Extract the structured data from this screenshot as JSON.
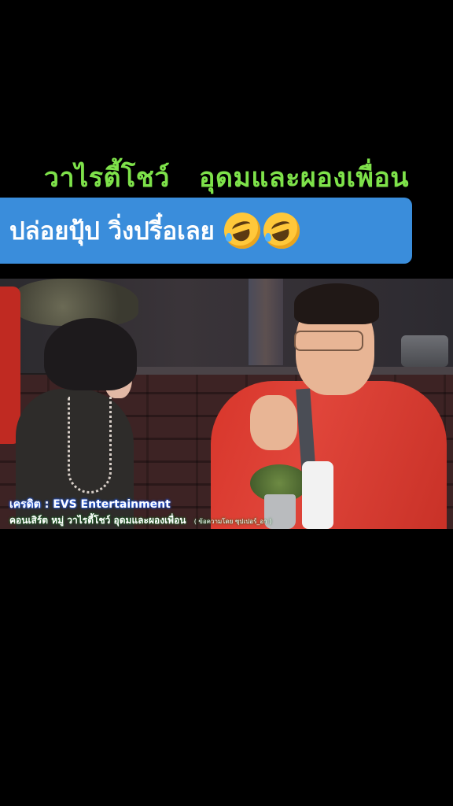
{
  "title": "วาไรตี้โชว์   อุดมและผองเพื่อน",
  "caption": {
    "text": "ปล่อยปุ้ป วิ่งปรี๋อเลย",
    "emojis": [
      "rolling-on-floor-laughing-icon",
      "rolling-on-floor-laughing-icon"
    ]
  },
  "video": {
    "credit": "เครดิต : EVS Entertainment",
    "subtitle": "คอนเสิร์ต หมู่ วาไรตี้โชว์ อุดมและผองเพื่อน",
    "subtitle_small": "( ข้อความโดย ซุปเปอร์_อา )"
  },
  "colors": {
    "title": "#7ee24a",
    "caption_box": "#3a8ddb",
    "background": "#000000"
  }
}
